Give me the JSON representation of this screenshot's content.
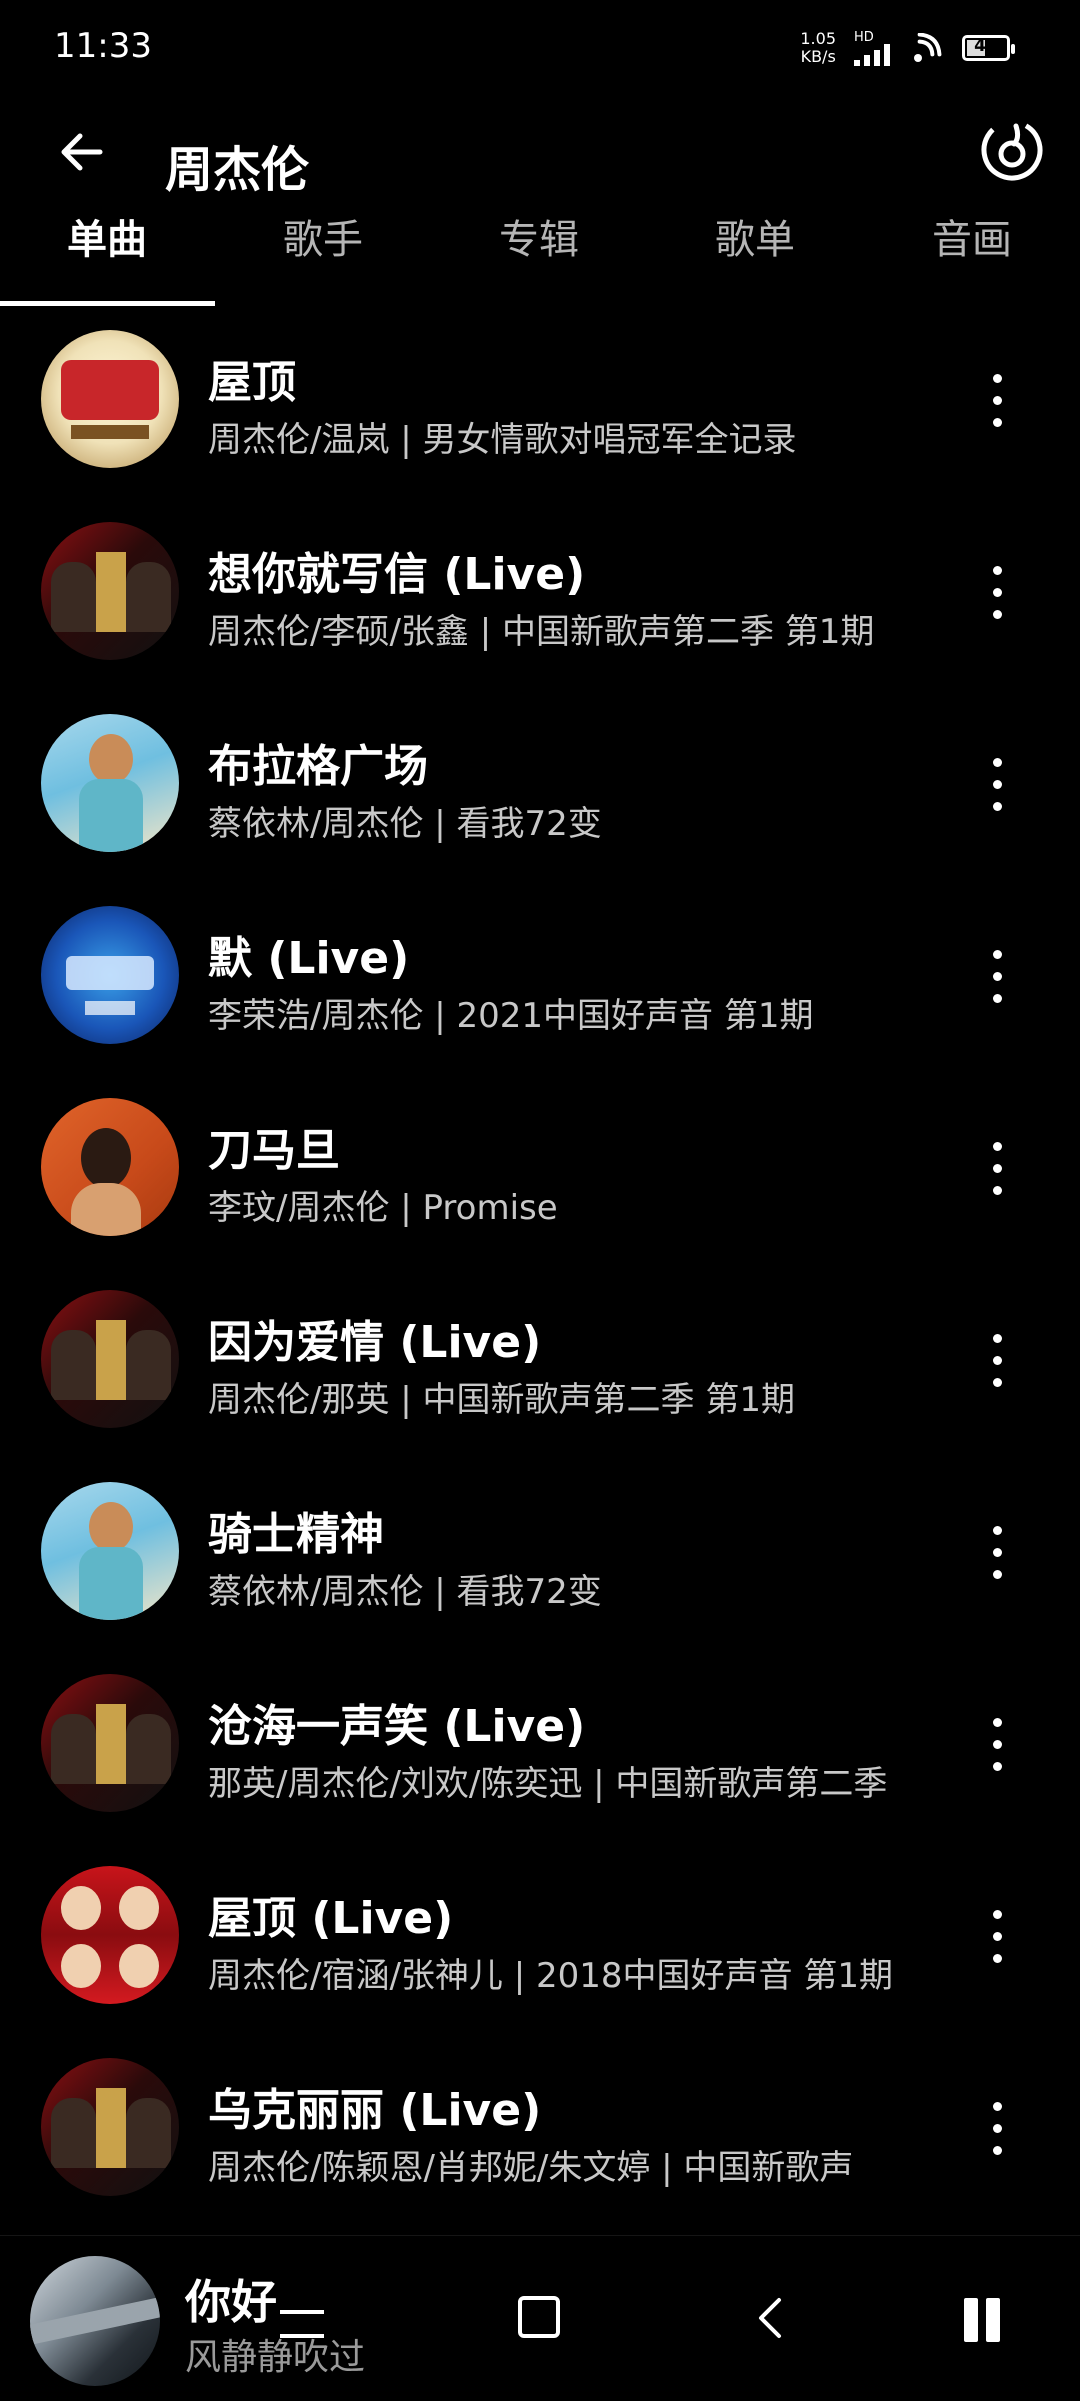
{
  "status_bar": {
    "time": "11:33",
    "net_speed_value": "1.05",
    "net_speed_unit": "KB/s",
    "signal_label": "HD",
    "battery": "47",
    "battery_level": 0.47
  },
  "header": {
    "title": "周杰伦",
    "back_icon": "arrow-left-icon",
    "brand_icon": "netease-music-icon"
  },
  "tabs": [
    {
      "label": "单曲",
      "active": true
    },
    {
      "label": "歌手",
      "active": false
    },
    {
      "label": "专辑",
      "active": false
    },
    {
      "label": "歌单",
      "active": false
    },
    {
      "label": "音画",
      "active": false
    }
  ],
  "songs": [
    {
      "title": "屋顶",
      "subtitle": "周杰伦/温岚 |  男女情歌对唱冠军全记录"
    },
    {
      "title": "想你就写信 (Live)",
      "subtitle": "周杰伦/李硕/张鑫 |  中国新歌声第二季 第1期"
    },
    {
      "title": "布拉格广场",
      "subtitle": "蔡依林/周杰伦 |  看我72变"
    },
    {
      "title": "默 (Live)",
      "subtitle": "李荣浩/周杰伦 |  2021中国好声音 第1期"
    },
    {
      "title": "刀马旦",
      "subtitle": "李玟/周杰伦 |  Promise"
    },
    {
      "title": "因为爱情 (Live)",
      "subtitle": "周杰伦/那英 |  中国新歌声第二季 第1期"
    },
    {
      "title": "骑士精神",
      "subtitle": "蔡依林/周杰伦 |  看我72变"
    },
    {
      "title": "沧海一声笑 (Live)",
      "subtitle": "那英/周杰伦/刘欢/陈奕迅 |  中国新歌声第二季"
    },
    {
      "title": "屋顶 (Live)",
      "subtitle": "周杰伦/宿涵/张神儿 |  2018中国好声音 第1期"
    },
    {
      "title": "乌克丽丽 (Live)",
      "subtitle": "周杰伦/陈颖恩/肖邦妮/朱文婷 |  中国新歌声"
    }
  ],
  "player": {
    "title": "你好",
    "subtitle": "风静静吹过"
  }
}
